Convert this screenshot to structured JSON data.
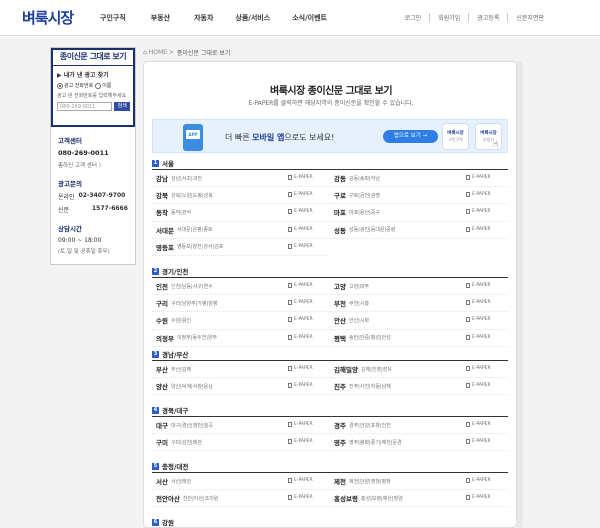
{
  "header": {
    "logo": "벼룩시장",
    "menu": [
      "구인구직",
      "부동산",
      "자동차",
      "상품/서비스",
      "소식/이벤트"
    ],
    "util": [
      "로그인",
      "회원가입",
      "광고등록",
      "신문지면판"
    ]
  },
  "sidebar": {
    "title": "종이신문 그대로 보기",
    "question": "내가 낸 광고 찾기",
    "radio_options": [
      "광고 전화번호",
      "이름"
    ],
    "note": "광고 낸 전화번호를 입력해주세요",
    "input_placeholder": "080-269-0011",
    "search_button": "검색",
    "customer_center": {
      "title": "고객센터",
      "phone": "080-269-0011",
      "link": "총하인 고객 센터 〉"
    },
    "ad_inquiry": {
      "title": "광고문의",
      "online_label": "온라인",
      "online_phone": "02-3407-9700",
      "newspaper_label": "신문",
      "newspaper_phone": "1577-6666"
    },
    "consult": {
      "title": "상담시간",
      "hours": "09:00 ~ 18:00",
      "note": "(토,일 및 공휴일 휴무)"
    }
  },
  "breadcrumb": {
    "home": "HOME",
    "current": "종이신문 그대로 보기"
  },
  "main": {
    "title": "벼룩시장 종이신문 그대로 보기",
    "subtitle": "E-PAPER를 클릭하면 해당지역의 종이신문을 확인할 수 있습니다.",
    "banner": {
      "app_label": "APP",
      "text_prefix": "더 빠른 ",
      "text_bold": "모바일 앱",
      "text_suffix": "으로도 보세요!",
      "button": "앱으로 보기 →",
      "icon1_title": "벼룩시장",
      "icon1_sub": "구인구직",
      "icon2_title": "벼룩시장",
      "icon2_sub": "부동산"
    },
    "epaper_label": "E-PAPER",
    "regions": [
      {
        "num": "1",
        "name": "서울",
        "items": [
          {
            "name": "강남",
            "districts": "강남|서초|과천"
          },
          {
            "name": "강동",
            "districts": "강동|송파|하남"
          },
          {
            "name": "강북",
            "districts": "강북|노원|도봉|성북"
          },
          {
            "name": "구로",
            "districts": "구로|금천|광명"
          },
          {
            "name": "동작",
            "districts": "동작|관악"
          },
          {
            "name": "마포",
            "districts": "마포|용산|중구"
          },
          {
            "name": "서대문",
            "districts": "서대문|은평|종로"
          },
          {
            "name": "성동",
            "districts": "성동|광진|동대문|중랑"
          },
          {
            "name": "영등포",
            "districts": "영등포|양천|강서|김포"
          }
        ]
      },
      {
        "num": "2",
        "name": "경기/인천",
        "items": [
          {
            "name": "인천",
            "districts": "인천|남동|서구|연수"
          },
          {
            "name": "고양",
            "districts": "고양|파주"
          },
          {
            "name": "구리",
            "districts": "구리|남양주|가평|양평"
          },
          {
            "name": "부천",
            "districts": "부천|시흥"
          },
          {
            "name": "수원",
            "districts": "수원|용인"
          },
          {
            "name": "안산",
            "districts": "안산|시화"
          },
          {
            "name": "의정부",
            "districts": "의정부|동두천|양주"
          },
          {
            "name": "평택",
            "districts": "송탄|안중|평성|안성"
          }
        ]
      },
      {
        "num": "3",
        "name": "경남/부산",
        "items": [
          {
            "name": "부산",
            "districts": "부산|김해"
          },
          {
            "name": "김해밀양",
            "districts": "김해|진영|장유"
          },
          {
            "name": "양산",
            "districts": "양산|덕계|서창|웅상"
          },
          {
            "name": "진주",
            "districts": "진주|사천|하동|남해"
          }
        ]
      },
      {
        "num": "4",
        "name": "경북/대구",
        "items": [
          {
            "name": "대구",
            "districts": "대구|경산|영천|칠곡"
          },
          {
            "name": "경주",
            "districts": "경주|안강|포항|건천"
          },
          {
            "name": "구미",
            "districts": "구미|김천|왜관"
          },
          {
            "name": "영주",
            "districts": "영주|봉화|풍기|예천|문경"
          }
        ]
      },
      {
        "num": "5",
        "name": "충청/대전",
        "items": [
          {
            "name": "서산",
            "districts": "서산|태안"
          },
          {
            "name": "제천",
            "districts": "제천|단양|영월|평창"
          },
          {
            "name": "천안아산",
            "districts": "천안|아산|조치원"
          },
          {
            "name": "홍성보령",
            "districts": "홍성|보령|예산|청양"
          }
        ]
      },
      {
        "num": "6",
        "name": "강원",
        "items": []
      }
    ]
  }
}
